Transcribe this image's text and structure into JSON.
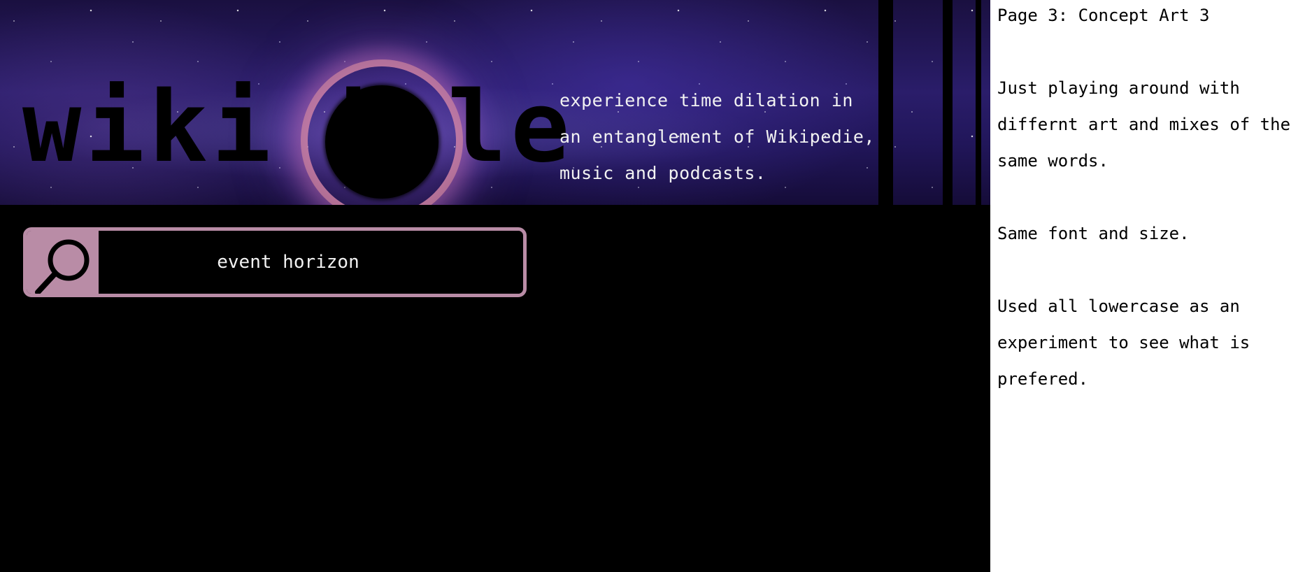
{
  "banner": {
    "logo_left": "wiki h",
    "logo_right": "le",
    "tagline": "experience time dilation in an entanglement of Wikipedie, music and podcasts."
  },
  "search": {
    "icon": "search-icon",
    "value": "event horizon",
    "accent_color": "#b98ca6"
  },
  "notes": {
    "title": "Page 3: Concept Art 3",
    "paragraphs": [
      "Just playing around with differnt art and mixes of the same words.",
      "Same font and size.",
      "Used all lowercase as an experiment to see what is prefered."
    ]
  }
}
